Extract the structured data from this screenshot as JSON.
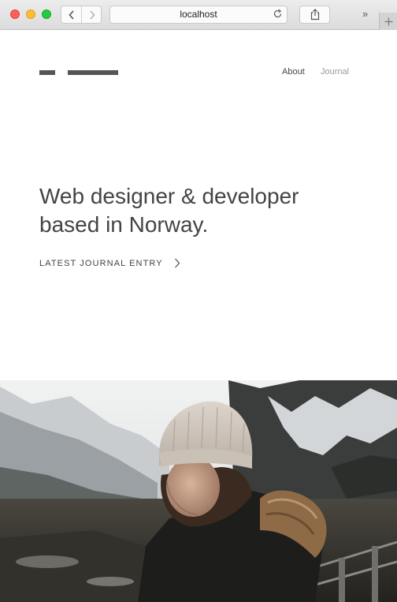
{
  "browser": {
    "url": "localhost",
    "icons": {
      "close": "close-light",
      "minimize": "minimize-light",
      "zoom": "zoom-light",
      "back": "chevron-left-icon",
      "forward": "chevron-right-icon",
      "reload": "reload-icon",
      "share": "share-icon",
      "overflow": "double-chevron-icon",
      "new_tab": "plus-icon"
    },
    "overflow_label": "»"
  },
  "site": {
    "nav": {
      "about": "About",
      "journal": "Journal"
    },
    "hero": {
      "line1": "Web designer & developer",
      "line2": "based in Norway."
    },
    "cta": {
      "label": "LATEST JOURNAL ENTRY"
    },
    "photo": {
      "subject": "woman in knit beanie and fur-trimmed parka before snowy mountains"
    }
  },
  "colors": {
    "text": "#444444",
    "muted": "#9a9a9a",
    "logo": "#555555"
  }
}
